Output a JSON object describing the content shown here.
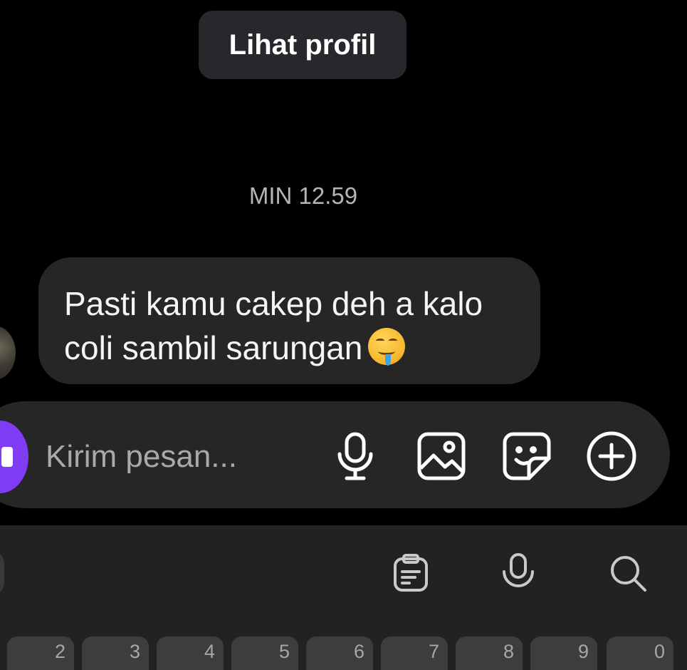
{
  "header": {
    "profile_button_label": "Lihat profil"
  },
  "conversation": {
    "timestamp": "MIN 12.59",
    "message": {
      "line1": "Pasti kamu cakep deh a kalo",
      "line2": "coli sambil sarungan"
    }
  },
  "composer": {
    "placeholder": "Kirim pesan...",
    "icons": [
      "camera-icon",
      "microphone-icon",
      "image-icon",
      "sticker-icon",
      "plus-circle-icon"
    ],
    "camera_color": "#7f3cf4"
  },
  "keyboard": {
    "toolbar_icons": [
      "clipboard-icon",
      "microphone-icon",
      "search-icon"
    ],
    "number_keys": [
      "2",
      "3",
      "4",
      "5",
      "6",
      "7",
      "8",
      "9",
      "0"
    ]
  },
  "colors": {
    "background": "#000000",
    "bubble": "#262626",
    "profile_button": "#26282c",
    "keyboard": "#222222",
    "key": "#3d3d3d"
  }
}
